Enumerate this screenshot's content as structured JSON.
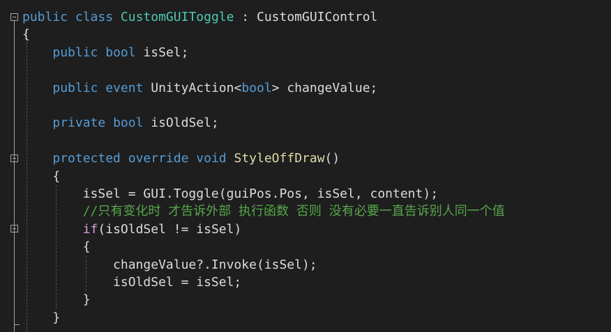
{
  "editor": {
    "colors": {
      "background": "#1e1e1e",
      "keyword": "#569cd6",
      "type": "#4ec9b0",
      "method": "#dcdcaa",
      "control": "#d8a0df",
      "comment": "#57a64a",
      "plain": "#dcdcdc"
    },
    "lines": [
      {
        "tokens": [
          {
            "t": "public",
            "k": "kw"
          },
          {
            "t": " "
          },
          {
            "t": "class",
            "k": "kw"
          },
          {
            "t": " "
          },
          {
            "t": "CustomGUIToggle",
            "k": "type"
          },
          {
            "t": " : CustomGUIControl"
          }
        ]
      },
      {
        "tokens": [
          {
            "t": "{"
          }
        ]
      },
      {
        "tokens": [
          {
            "t": "    "
          },
          {
            "t": "public",
            "k": "kw"
          },
          {
            "t": " "
          },
          {
            "t": "bool",
            "k": "kw"
          },
          {
            "t": " isSel;"
          }
        ]
      },
      {
        "tokens": []
      },
      {
        "tokens": [
          {
            "t": "    "
          },
          {
            "t": "public",
            "k": "kw"
          },
          {
            "t": " "
          },
          {
            "t": "event",
            "k": "kw"
          },
          {
            "t": " UnityAction<"
          },
          {
            "t": "bool",
            "k": "kw"
          },
          {
            "t": "> changeValue;"
          }
        ]
      },
      {
        "tokens": []
      },
      {
        "tokens": [
          {
            "t": "    "
          },
          {
            "t": "private",
            "k": "kw"
          },
          {
            "t": " "
          },
          {
            "t": "bool",
            "k": "kw"
          },
          {
            "t": " isOldSel;"
          }
        ]
      },
      {
        "tokens": []
      },
      {
        "tokens": [
          {
            "t": "    "
          },
          {
            "t": "protected",
            "k": "kw"
          },
          {
            "t": " "
          },
          {
            "t": "override",
            "k": "kw"
          },
          {
            "t": " "
          },
          {
            "t": "void",
            "k": "kw"
          },
          {
            "t": " "
          },
          {
            "t": "StyleOffDraw",
            "k": "method"
          },
          {
            "t": "()"
          }
        ]
      },
      {
        "tokens": [
          {
            "t": "    {"
          }
        ]
      },
      {
        "tokens": [
          {
            "t": "        isSel = GUI.Toggle(guiPos.Pos, isSel, content);"
          }
        ]
      },
      {
        "tokens": [
          {
            "t": "        "
          },
          {
            "t": "//只有变化时 才告诉外部 执行函数 否则 没有必要一直告诉别人同一个值",
            "k": "comment"
          }
        ]
      },
      {
        "tokens": [
          {
            "t": "        "
          },
          {
            "t": "if",
            "k": "ctrl"
          },
          {
            "t": "(isOldSel != isSel)"
          }
        ]
      },
      {
        "tokens": [
          {
            "t": "        {"
          }
        ]
      },
      {
        "tokens": [
          {
            "t": "            changeValue?.Invoke(isSel);"
          }
        ]
      },
      {
        "tokens": [
          {
            "t": "            isOldSel = isSel;"
          }
        ]
      },
      {
        "tokens": [
          {
            "t": "        }"
          }
        ]
      },
      {
        "tokens": [
          {
            "t": "    }"
          }
        ]
      }
    ]
  }
}
